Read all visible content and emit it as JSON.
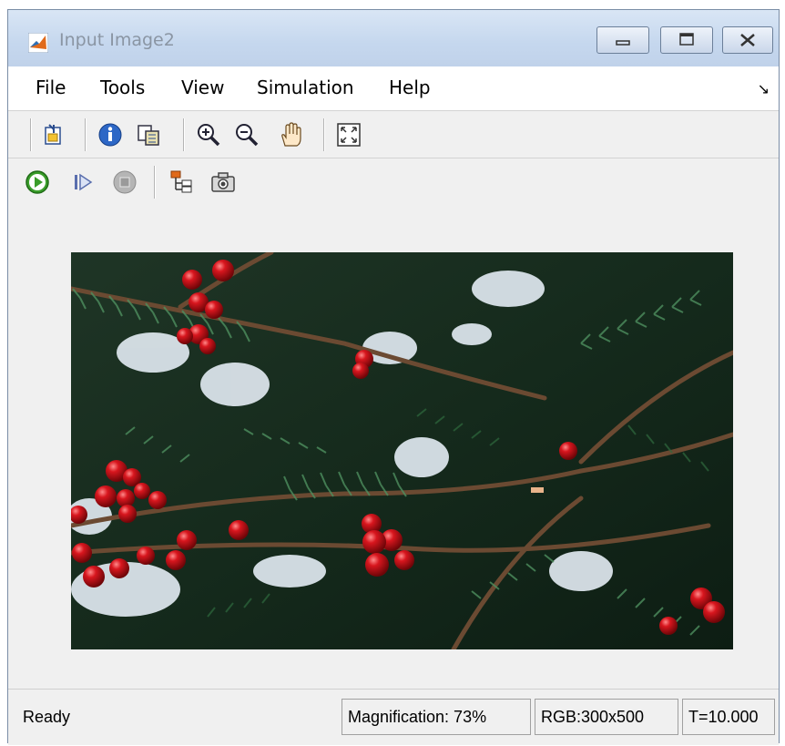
{
  "window": {
    "title": "Input Image2"
  },
  "menu": [
    "File",
    "Tools",
    "View",
    "Simulation",
    "Help"
  ],
  "toolbar1_icons": [
    "open-block-icon",
    "info-icon",
    "copy-figure-icon",
    "zoom-in-icon",
    "zoom-out-icon",
    "pan-hand-icon",
    "fit-to-window-icon"
  ],
  "toolbar2_icons": [
    "run-icon",
    "step-forward-icon",
    "stop-icon",
    "signal-hierarchy-icon",
    "snapshot-icon"
  ],
  "status": {
    "state": "Ready",
    "magnification": "Magnification: 73%",
    "rgb": "RGB:300x500",
    "time": "T=10.000"
  },
  "colors": {
    "run_green": "#3a9d2a",
    "berry_red": "#c0141c",
    "matlab_orange": "#e06a1b"
  }
}
